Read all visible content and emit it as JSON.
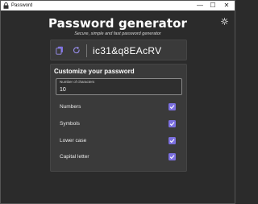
{
  "window": {
    "title": "Password",
    "minimize_glyph": "—",
    "maximize_glyph": "☐",
    "close_glyph": "✕"
  },
  "header": {
    "title": "Password generator",
    "subtitle": "Secure, simple and fast password generator",
    "theme_icon": "sun-icon"
  },
  "password_card": {
    "value": "ic31&q8EAcRV",
    "copy_icon": "copy-icon",
    "refresh_icon": "refresh-icon"
  },
  "settings": {
    "title": "Customize your password",
    "length": {
      "label": "Number of characters",
      "value": "10"
    },
    "options": [
      {
        "label": "Numbers",
        "checked": true
      },
      {
        "label": "Symbols",
        "checked": true
      },
      {
        "label": "Lower case",
        "checked": true
      },
      {
        "label": "Capital letter",
        "checked": true
      }
    ]
  },
  "colors": {
    "accent": "#7b6fe0",
    "background": "#2b2b2b",
    "card": "#3a3a3a"
  }
}
